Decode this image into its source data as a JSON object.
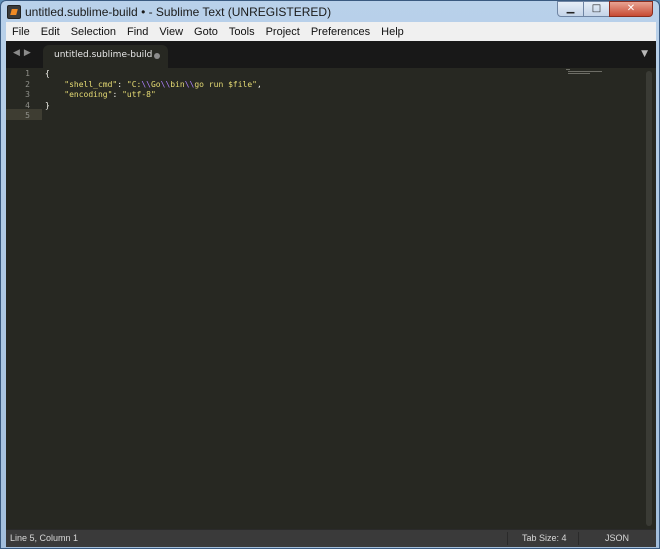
{
  "window": {
    "title": "untitled.sublime-build • - Sublime Text (UNREGISTERED)",
    "controls": {
      "minimize": "▁",
      "maximize": "□",
      "close": "✕"
    }
  },
  "menu": [
    {
      "label": "File"
    },
    {
      "label": "Edit"
    },
    {
      "label": "Selection"
    },
    {
      "label": "Find"
    },
    {
      "label": "View"
    },
    {
      "label": "Goto"
    },
    {
      "label": "Tools"
    },
    {
      "label": "Project"
    },
    {
      "label": "Preferences"
    },
    {
      "label": "Help"
    }
  ],
  "tabs": {
    "nav_back": "◀",
    "nav_forward": "▶",
    "active_tab": "untitled.sublime-build",
    "dropdown": "▼"
  },
  "editor": {
    "line_numbers": [
      "1",
      "2",
      "3",
      "4",
      "5"
    ],
    "lines": [
      "{",
      "    \"shell_cmd\": \"C:\\\\Go\\\\bin\\\\go run $file\",",
      "    \"encoding\": \"utf-8\"",
      "}",
      ""
    ]
  },
  "status": {
    "position": "Line 5, Column 1",
    "tab_size": "Tab Size: 4",
    "syntax": "JSON"
  }
}
